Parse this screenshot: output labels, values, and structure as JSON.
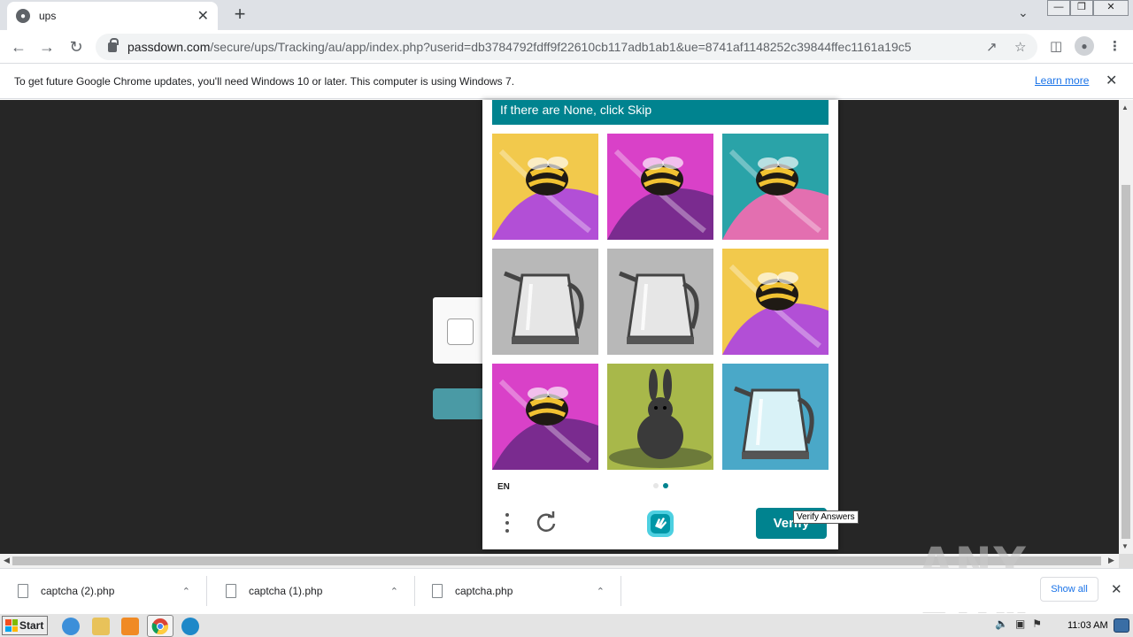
{
  "browser": {
    "tab_title": "ups",
    "url_host": "passdown.com",
    "url_path": "/secure/ups/Tracking/au/app/index.php?userid=db3784792fdff9f22610cb117adb1ab1&ue=8741af1148252c39844ffec1161a19c5",
    "infobar_text": "To get future Google Chrome updates, you'll need Windows 10 or later. This computer is using Windows 7.",
    "infobar_link": "Learn more"
  },
  "captcha": {
    "prompt": "If there are None, click Skip",
    "language": "EN",
    "verify_label": "Verify",
    "tooltip": "Verify Answers",
    "tiles": [
      "bee",
      "bee",
      "bee",
      "kettle",
      "kettle",
      "bee",
      "bee",
      "rabbit",
      "kettle"
    ],
    "page_dots": 2,
    "active_dot": 1
  },
  "downloads": {
    "items": [
      "captcha (2).php",
      "captcha (1).php",
      "captcha.php"
    ],
    "show_all": "Show all"
  },
  "taskbar": {
    "start_label": "Start",
    "clock": "11:03 AM"
  },
  "watermark": "ANY RUN",
  "colors": {
    "accent": "#00838f",
    "page_bg": "#262626"
  }
}
